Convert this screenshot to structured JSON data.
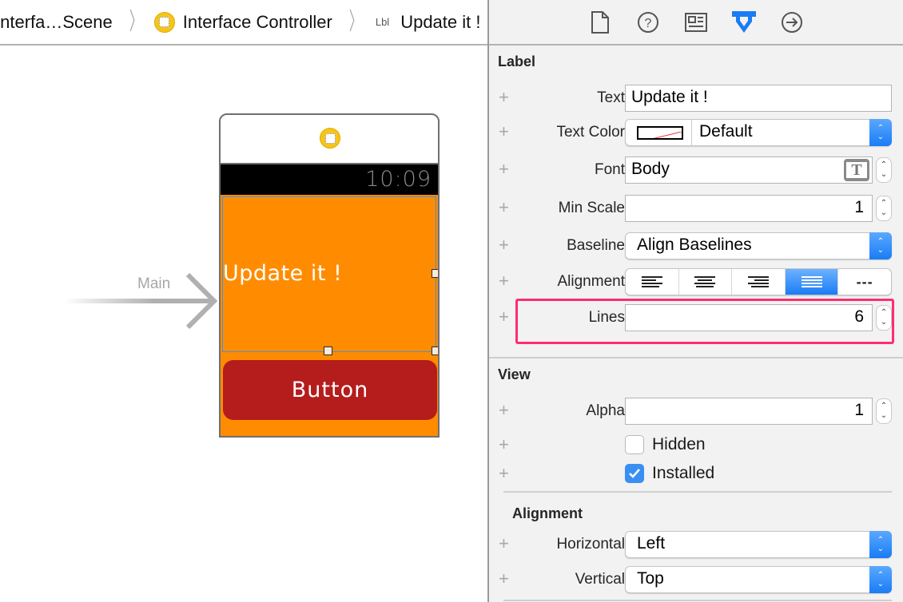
{
  "breadcrumb": {
    "items": [
      {
        "label": "Interfa…Scene"
      },
      {
        "label": "Interface Controller"
      },
      {
        "tag": "Lbl",
        "label": "Update it !"
      }
    ]
  },
  "canvas": {
    "entry_point_label": "Main",
    "watch": {
      "status_time": "10:09",
      "label_text": "Update it !",
      "button_label": "Button"
    }
  },
  "inspector": {
    "tabs": [
      {
        "icon": "file-icon",
        "active": false
      },
      {
        "icon": "help-icon",
        "active": false
      },
      {
        "icon": "identity-icon",
        "active": false
      },
      {
        "icon": "attributes-icon",
        "active": true
      },
      {
        "icon": "connections-icon",
        "active": false
      }
    ],
    "label_section": {
      "title": "Label",
      "text": {
        "label": "Text",
        "value": "Update it !"
      },
      "text_color": {
        "label": "Text Color",
        "value": "Default"
      },
      "font": {
        "label": "Font",
        "value": "Body"
      },
      "min_scale": {
        "label": "Min Scale",
        "value": "1"
      },
      "baseline": {
        "label": "Baseline",
        "value": "Align Baselines"
      },
      "alignment": {
        "label": "Alignment",
        "options": [
          "left",
          "center",
          "right",
          "justified",
          "natural"
        ],
        "selected": "justified",
        "natural_glyph": "---"
      },
      "lines": {
        "label": "Lines",
        "value": "6"
      }
    },
    "view_section": {
      "title": "View",
      "alpha": {
        "label": "Alpha",
        "value": "1"
      },
      "hidden": {
        "label": "Hidden",
        "checked": false
      },
      "installed": {
        "label": "Installed",
        "checked": true
      }
    },
    "alignment_section": {
      "title": "Alignment",
      "horizontal": {
        "label": "Horizontal",
        "value": "Left"
      },
      "vertical": {
        "label": "Vertical",
        "value": "Top"
      }
    }
  },
  "colors": {
    "accent": "#1a7cf5",
    "highlight": "#ff2d6f",
    "watch_background": "#ff8c00",
    "button_background": "#b51c1c"
  }
}
